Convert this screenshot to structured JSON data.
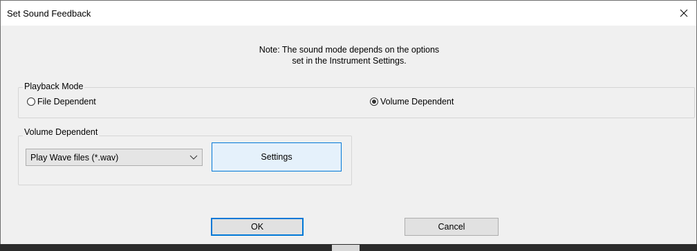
{
  "window": {
    "title": "Set Sound Feedback",
    "close_icon": "close-icon"
  },
  "note": {
    "line1": "Note: The sound mode depends on the options",
    "line2": "set in the Instrument Settings."
  },
  "playback_mode": {
    "label": "Playback Mode",
    "options": [
      {
        "label": "File Dependent",
        "checked": false
      },
      {
        "label": "Volume Dependent",
        "checked": true
      }
    ]
  },
  "volume_dependent": {
    "label": "Volume Dependent",
    "combo_value": "Play Wave files (*.wav)",
    "settings_label": "Settings"
  },
  "buttons": {
    "ok": "OK",
    "cancel": "Cancel"
  }
}
